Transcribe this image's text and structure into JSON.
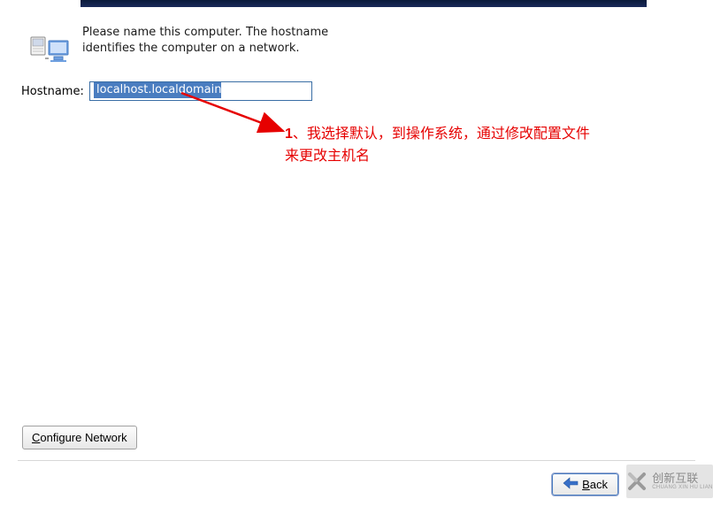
{
  "intro_text": "Please name this computer.  The hostname identifies the computer on a network.",
  "hostname": {
    "label": "Hostname:",
    "value": "localhost.localdomain"
  },
  "annotation": {
    "num": "1",
    "sep": "、",
    "text": "我选择默认，到操作系统，通过修改配置文件来更改主机名"
  },
  "buttons": {
    "configure_network_prefix": "C",
    "configure_network_rest": "onfigure Network",
    "back_prefix": "B",
    "back_rest": "ack"
  },
  "watermark": {
    "cn": "创新互联",
    "en": "CHUANG XIN HU LIAN"
  },
  "icons": {
    "back_arrow": "back-arrow-icon",
    "computers": "network-computers-icon",
    "wm": "x-logo-icon"
  },
  "colors": {
    "annotation": "#e60000",
    "selection": "#4a7dc0"
  }
}
